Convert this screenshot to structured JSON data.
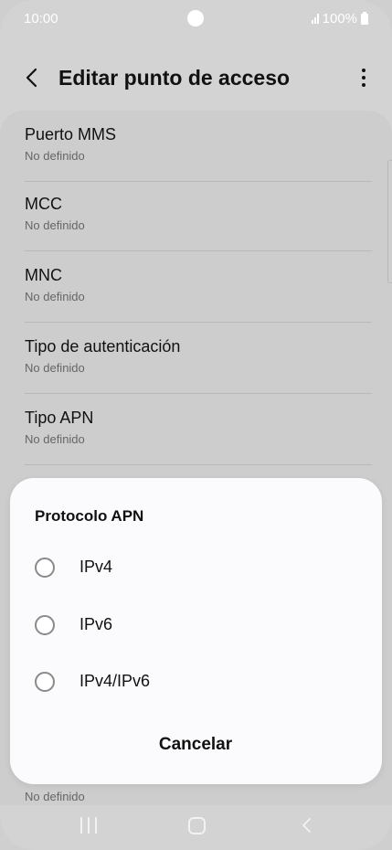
{
  "status_bar": {
    "time": "10:00",
    "battery": "100%"
  },
  "app_bar": {
    "title": "Editar punto de acceso"
  },
  "settings": [
    {
      "title": "Puerto MMS",
      "value": "No definido"
    },
    {
      "title": "MCC",
      "value": "No definido"
    },
    {
      "title": "MNC",
      "value": "No definido"
    },
    {
      "title": "Tipo de autenticación",
      "value": "No definido"
    },
    {
      "title": "Tipo APN",
      "value": "No definido"
    }
  ],
  "peek_value": "No definido",
  "dialog": {
    "title": "Protocolo APN",
    "options": [
      {
        "label": "IPv4",
        "selected": false
      },
      {
        "label": "IPv6",
        "selected": false
      },
      {
        "label": "IPv4/IPv6",
        "selected": false
      }
    ],
    "cancel_label": "Cancelar"
  },
  "colors": {
    "background": "#d3d3d3",
    "dialog": "#fbfbfd",
    "text": "#111111",
    "secondary_text": "#666666"
  },
  "icons": {
    "back": "chevron-left-icon",
    "more": "more-vertical-icon",
    "signal": "signal-icon",
    "battery": "battery-icon",
    "nav_recent": "recent-apps-icon",
    "nav_home": "home-icon",
    "nav_back": "back-icon"
  }
}
